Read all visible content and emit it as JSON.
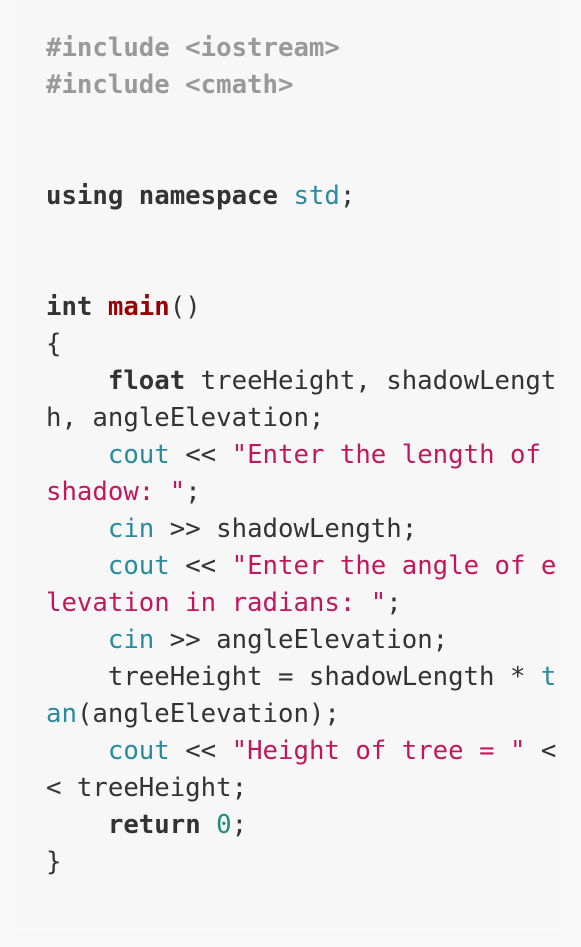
{
  "code_block": {
    "language": "cpp",
    "colors": {
      "preprocessor": "#999999",
      "keyword": "#333333",
      "namespace": "#2a8aa0",
      "function": "#990000",
      "builtin": "#2a8aa0",
      "string": "#c2185b",
      "number": "#1f8a80"
    },
    "lines": [
      [
        {
          "t": "#include <iostream>",
          "c": "pre"
        }
      ],
      [
        {
          "t": "#include <cmath>",
          "c": "pre"
        }
      ],
      [],
      [],
      [
        {
          "t": "using namespace",
          "c": "kw"
        },
        {
          "t": " ",
          "c": "id"
        },
        {
          "t": "std",
          "c": "ns"
        },
        {
          "t": ";",
          "c": "op"
        }
      ],
      [],
      [],
      [
        {
          "t": "int",
          "c": "kw"
        },
        {
          "t": " ",
          "c": "id"
        },
        {
          "t": "main",
          "c": "fn"
        },
        {
          "t": "()",
          "c": "op"
        }
      ],
      [
        {
          "t": "{",
          "c": "op"
        }
      ],
      [
        {
          "t": "    ",
          "c": "id"
        },
        {
          "t": "float",
          "c": "kw"
        },
        {
          "t": " treeHeight, shadowLengt",
          "c": "id"
        }
      ],
      [
        {
          "t": "h, angleElevation;",
          "c": "id"
        }
      ],
      [
        {
          "t": "    ",
          "c": "id"
        },
        {
          "t": "cout",
          "c": "builtin"
        },
        {
          "t": " << ",
          "c": "op"
        },
        {
          "t": "\"Enter the length of",
          "c": "str"
        }
      ],
      [
        {
          "t": "shadow: \"",
          "c": "str"
        },
        {
          "t": ";",
          "c": "op"
        }
      ],
      [
        {
          "t": "    ",
          "c": "id"
        },
        {
          "t": "cin",
          "c": "builtin"
        },
        {
          "t": " >> shadowLength;",
          "c": "id"
        }
      ],
      [
        {
          "t": "    ",
          "c": "id"
        },
        {
          "t": "cout",
          "c": "builtin"
        },
        {
          "t": " << ",
          "c": "op"
        },
        {
          "t": "\"Enter the angle of e",
          "c": "str"
        }
      ],
      [
        {
          "t": "levation in radians: \"",
          "c": "str"
        },
        {
          "t": ";",
          "c": "op"
        }
      ],
      [
        {
          "t": "    ",
          "c": "id"
        },
        {
          "t": "cin",
          "c": "builtin"
        },
        {
          "t": " >> angleElevation;",
          "c": "id"
        }
      ],
      [
        {
          "t": "    treeHeight = shadowLength * ",
          "c": "id"
        },
        {
          "t": "t",
          "c": "builtin"
        }
      ],
      [
        {
          "t": "an",
          "c": "builtin"
        },
        {
          "t": "(angleElevation);",
          "c": "id"
        }
      ],
      [
        {
          "t": "    ",
          "c": "id"
        },
        {
          "t": "cout",
          "c": "builtin"
        },
        {
          "t": " << ",
          "c": "op"
        },
        {
          "t": "\"Height of tree = \"",
          "c": "str"
        },
        {
          "t": " <",
          "c": "op"
        }
      ],
      [
        {
          "t": "< treeHeight;",
          "c": "id"
        }
      ],
      [
        {
          "t": "    ",
          "c": "id"
        },
        {
          "t": "return",
          "c": "kw"
        },
        {
          "t": " ",
          "c": "id"
        },
        {
          "t": "0",
          "c": "num"
        },
        {
          "t": ";",
          "c": "op"
        }
      ],
      [
        {
          "t": "}",
          "c": "op"
        }
      ]
    ]
  }
}
